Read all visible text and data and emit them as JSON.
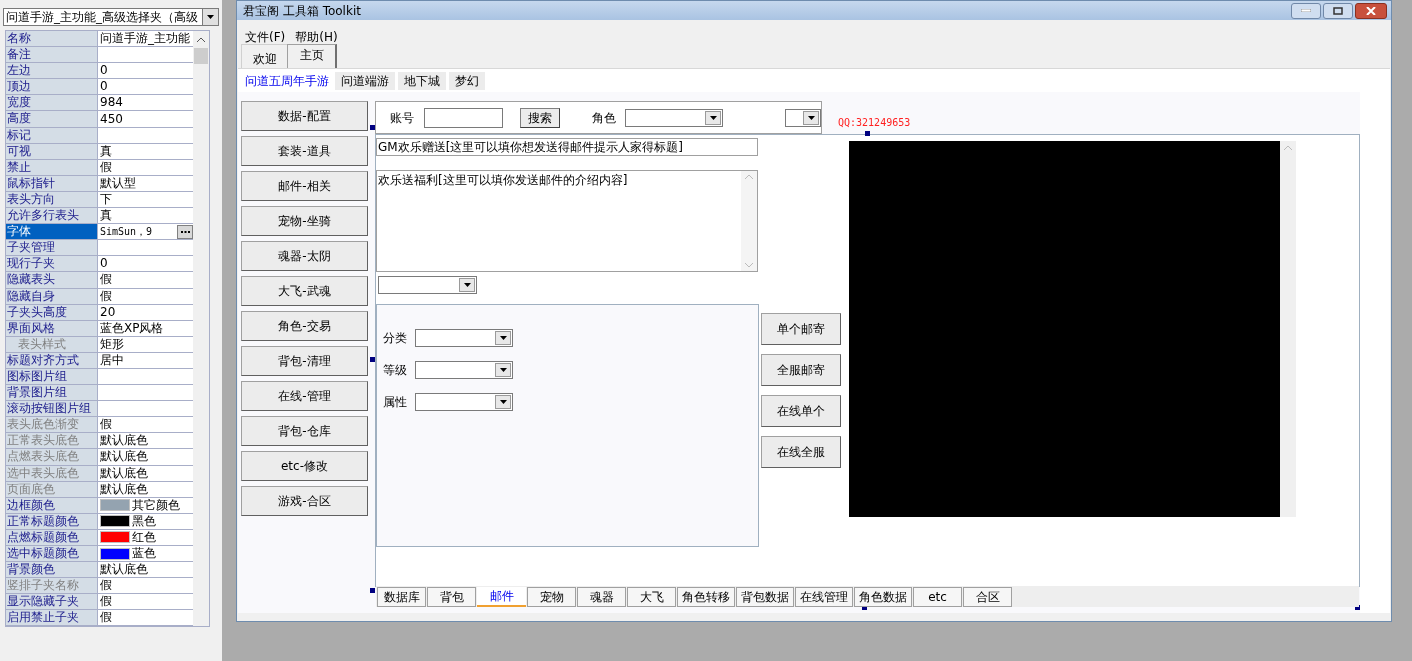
{
  "object_selector": {
    "value": "问道手游_主功能_高级选择夹（高级"
  },
  "properties": [
    {
      "name": "名称",
      "value": "问道手游_主功能",
      "kind": "text",
      "disabled": false,
      "selected": false
    },
    {
      "name": "备注",
      "kind": "text",
      "disabled": false,
      "selected": false
    },
    {
      "name": "左边",
      "value": "0",
      "kind": "text",
      "disabled": false,
      "selected": false
    },
    {
      "name": "顶边",
      "value": "0",
      "kind": "text",
      "disabled": false,
      "selected": false
    },
    {
      "name": "宽度",
      "value": "984",
      "kind": "text",
      "disabled": false,
      "selected": false
    },
    {
      "name": "高度",
      "value": "450",
      "kind": "text",
      "disabled": false,
      "selected": false
    },
    {
      "name": "标记",
      "kind": "text",
      "disabled": false,
      "selected": false
    },
    {
      "name": "可视",
      "value": "真",
      "kind": "text",
      "disabled": false,
      "selected": false
    },
    {
      "name": "禁止",
      "value": "假",
      "kind": "text",
      "disabled": false,
      "selected": false
    },
    {
      "name": "鼠标指针",
      "value": "默认型",
      "kind": "text",
      "disabled": false,
      "selected": false
    },
    {
      "name": "表头方向",
      "value": "下",
      "kind": "text",
      "disabled": false,
      "selected": false
    },
    {
      "name": "允许多行表头",
      "value": "真",
      "kind": "text",
      "disabled": false,
      "selected": false
    },
    {
      "name": "字体",
      "value": "SimSun，9",
      "kind": "font",
      "disabled": false,
      "selected": true
    },
    {
      "name": "子夹管理",
      "kind": "text",
      "disabled": false,
      "selected": false
    },
    {
      "name": "现行子夹",
      "value": "0",
      "kind": "text",
      "disabled": false,
      "selected": false
    },
    {
      "name": "隐藏表头",
      "value": "假",
      "kind": "text",
      "disabled": false,
      "selected": false
    },
    {
      "name": "隐藏自身",
      "value": "假",
      "kind": "text",
      "disabled": false,
      "selected": false
    },
    {
      "name": "子夹头高度",
      "value": "20",
      "kind": "text",
      "disabled": false,
      "selected": false
    },
    {
      "name": "界面风格",
      "value": "蓝色XP风格",
      "kind": "text",
      "disabled": false,
      "selected": false,
      "children": [
        {
          "name": "表头样式",
          "value": "矩形",
          "kind": "text",
          "disabled": true,
          "selected": false
        }
      ]
    },
    {
      "name": "标题对齐方式",
      "value": "居中",
      "kind": "text",
      "disabled": false,
      "selected": false
    },
    {
      "name": "图标图片组",
      "kind": "text",
      "disabled": false,
      "selected": false
    },
    {
      "name": "背景图片组",
      "kind": "text",
      "disabled": false,
      "selected": false
    },
    {
      "name": "滚动按钮图片组",
      "kind": "text",
      "disabled": false,
      "selected": false
    },
    {
      "name": "表头底色渐变",
      "value": "假",
      "kind": "text",
      "disabled": true,
      "selected": false
    },
    {
      "name": "正常表头底色",
      "value": "默认底色",
      "kind": "text",
      "disabled": true,
      "selected": false
    },
    {
      "name": "点燃表头底色",
      "value": "默认底色",
      "kind": "text",
      "disabled": true,
      "selected": false
    },
    {
      "name": "选中表头底色",
      "value": "默认底色",
      "kind": "text",
      "disabled": true,
      "selected": false
    },
    {
      "name": "页面底色",
      "value": "默认底色",
      "kind": "text",
      "disabled": true,
      "selected": false
    },
    {
      "name": "边框颜色",
      "value": "其它颜色",
      "kind": "color",
      "color": "#94a3b0",
      "disabled": false,
      "selected": false
    },
    {
      "name": "正常标题颜色",
      "value": "黑色",
      "kind": "color",
      "color": "#000000",
      "disabled": false,
      "selected": false
    },
    {
      "name": "点燃标题颜色",
      "value": "红色",
      "kind": "color",
      "color": "#ff0000",
      "disabled": false,
      "selected": false
    },
    {
      "name": "选中标题颜色",
      "value": "蓝色",
      "kind": "color",
      "color": "#0000ff",
      "disabled": false,
      "selected": false
    },
    {
      "name": "背景颜色",
      "value": "默认底色",
      "kind": "text",
      "disabled": false,
      "selected": false
    },
    {
      "name": "竖排子夹名称",
      "value": "假",
      "kind": "text",
      "disabled": true,
      "selected": false
    },
    {
      "name": "显示隐藏子夹",
      "value": "假",
      "kind": "text",
      "disabled": false,
      "selected": false
    },
    {
      "name": "启用禁止子夹",
      "value": "假",
      "kind": "text",
      "disabled": false,
      "selected": false
    }
  ],
  "window": {
    "title": "君宝阁 工具箱 Toolkit"
  },
  "menu": [
    "文件(F)",
    "帮助(H)"
  ],
  "tabs": [
    {
      "label": "欢迎",
      "selected": false
    },
    {
      "label": "主页",
      "selected": true
    }
  ],
  "game_tabs": [
    {
      "label": "问道五周年手游",
      "selected": true
    },
    {
      "label": "问道端游",
      "selected": false
    },
    {
      "label": "地下城",
      "selected": false
    },
    {
      "label": "梦幻",
      "selected": false
    }
  ],
  "side_buttons": [
    "数据-配置",
    "套装-道具",
    "邮件-相关",
    "宠物-坐骑",
    "魂器-太阴",
    "大飞-武魂",
    "角色-交易",
    "背包-清理",
    "在线-管理",
    "背包-仓库",
    "etc-修改",
    "游戏-合区"
  ],
  "search_row": {
    "account_label": "账号",
    "search_button": "搜索",
    "role_label": "角色"
  },
  "qq": "QQ:321249653",
  "mail_title": {
    "value": "GM欢乐赠送[这里可以填你想发送得邮件提示人家得标题]"
  },
  "mail_body": {
    "value": "欢乐送福利[这里可以填你发送邮件的介绍内容]"
  },
  "filters": [
    "分类",
    "等级",
    "属性"
  ],
  "send_buttons": [
    "单个邮寄",
    "全服邮寄",
    "在线单个",
    "在线全服"
  ],
  "bottom_tabs": [
    {
      "label": "数据库",
      "selected": false
    },
    {
      "label": "背包",
      "selected": false
    },
    {
      "label": "邮件",
      "selected": true
    },
    {
      "label": "宠物",
      "selected": false
    },
    {
      "label": "魂器",
      "selected": false
    },
    {
      "label": "大飞",
      "selected": false
    },
    {
      "label": "角色转移",
      "selected": false
    },
    {
      "label": "背包数据",
      "selected": false
    },
    {
      "label": "在线管理",
      "selected": false
    },
    {
      "label": "角色数据",
      "selected": false
    },
    {
      "label": "etc",
      "selected": false
    },
    {
      "label": "合区",
      "selected": false
    }
  ]
}
